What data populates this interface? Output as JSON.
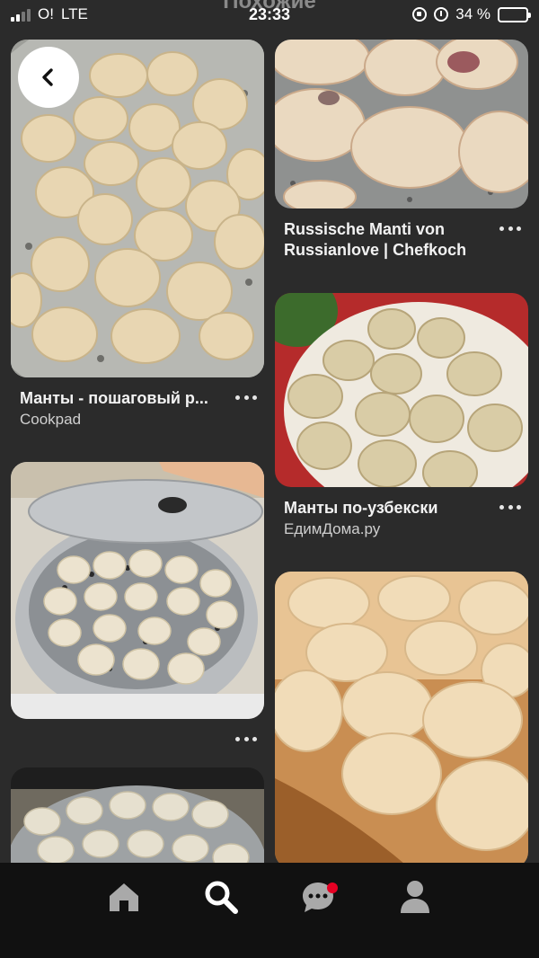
{
  "status_bar": {
    "carrier": "O!",
    "network": "LTE",
    "title_ghost": "Похожие",
    "time": "23:33",
    "battery_percent": "34 %",
    "battery_level": 0.34,
    "battery_color": "#f5c518"
  },
  "nav": {
    "back_icon": "chevron-left-icon"
  },
  "left_column": [
    {
      "title": "Манты - пошаговый р...",
      "source": "Cookpad",
      "image": "manti-steamer-tray"
    },
    {
      "title": "",
      "source": "",
      "image": "manti-steamer-lid"
    },
    {
      "title": "",
      "source": "",
      "image": "manti-steamer-partial"
    }
  ],
  "right_column": [
    {
      "title": "Russische Manti von Russianlove | Chefkoch",
      "source": "",
      "image": "manti-closeup"
    },
    {
      "title": "Манты по-узбекски",
      "source": "ЕдимДома.ру",
      "image": "manti-plate"
    },
    {
      "title": "",
      "source": "",
      "image": "manti-wooden-board"
    }
  ],
  "bottom_nav": {
    "items": [
      {
        "name": "home-icon"
      },
      {
        "name": "search-icon"
      },
      {
        "name": "messages-icon",
        "badge": true
      },
      {
        "name": "profile-icon"
      }
    ],
    "badge_color": "#e60023"
  }
}
